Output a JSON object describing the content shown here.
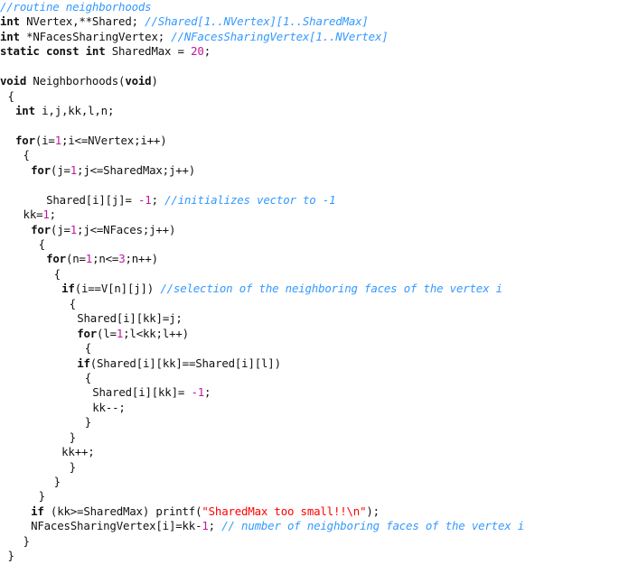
{
  "document": {
    "kind": "source-code-listing",
    "language": "C",
    "routine_name": "Neighborhoods"
  },
  "colors": {
    "text": "#111111",
    "keyword": "#111111",
    "number": "#C0179E",
    "comment": "#3399FF",
    "string": "#FF0000",
    "background": "#FFFFFF"
  },
  "code": {
    "lines": [
      {
        "indent": 0,
        "tokens": [
          {
            "t": "comment",
            "v": "//routine neighborhoods"
          }
        ]
      },
      {
        "indent": 0,
        "tokens": [
          {
            "t": "kw",
            "v": "int"
          },
          {
            "t": "plain",
            "v": " NVertex,**Shared; "
          },
          {
            "t": "comment",
            "v": "//Shared[1..NVertex][1..SharedMax]"
          }
        ]
      },
      {
        "indent": 0,
        "tokens": [
          {
            "t": "kw",
            "v": "int"
          },
          {
            "t": "plain",
            "v": " *NFacesSharingVertex; "
          },
          {
            "t": "comment",
            "v": "//NFacesSharingVertex[1..NVertex]"
          }
        ]
      },
      {
        "indent": 0,
        "tokens": [
          {
            "t": "kw",
            "v": "static const int"
          },
          {
            "t": "plain",
            "v": " SharedMax = "
          },
          {
            "t": "num",
            "v": "20"
          },
          {
            "t": "plain",
            "v": ";"
          }
        ]
      },
      {
        "indent": 0,
        "tokens": []
      },
      {
        "indent": 0,
        "tokens": [
          {
            "t": "kw",
            "v": "void"
          },
          {
            "t": "plain",
            "v": " Neighborhoods("
          },
          {
            "t": "kw",
            "v": "void"
          },
          {
            "t": "plain",
            "v": ")"
          }
        ]
      },
      {
        "indent": 1,
        "tokens": [
          {
            "t": "brace",
            "v": "{"
          }
        ]
      },
      {
        "indent": 2,
        "tokens": [
          {
            "t": "kw",
            "v": "int"
          },
          {
            "t": "plain",
            "v": " i,j,kk,l,n;"
          }
        ]
      },
      {
        "indent": 0,
        "tokens": []
      },
      {
        "indent": 2,
        "tokens": [
          {
            "t": "kw",
            "v": "for"
          },
          {
            "t": "plain",
            "v": "(i="
          },
          {
            "t": "num",
            "v": "1"
          },
          {
            "t": "plain",
            "v": ";i<=NVertex;i++)"
          }
        ]
      },
      {
        "indent": 3,
        "tokens": [
          {
            "t": "brace",
            "v": "{"
          }
        ]
      },
      {
        "indent": 4,
        "tokens": [
          {
            "t": "kw",
            "v": "for"
          },
          {
            "t": "plain",
            "v": "(j="
          },
          {
            "t": "num",
            "v": "1"
          },
          {
            "t": "plain",
            "v": ";j<=SharedMax;j++)"
          }
        ]
      },
      {
        "indent": 0,
        "tokens": []
      },
      {
        "indent": 6,
        "tokens": [
          {
            "t": "plain",
            "v": "Shared[i][j]= "
          },
          {
            "t": "num",
            "v": "-1"
          },
          {
            "t": "plain",
            "v": "; "
          },
          {
            "t": "comment",
            "v": "//initializes vector to -1"
          }
        ]
      },
      {
        "indent": 3,
        "tokens": [
          {
            "t": "plain",
            "v": "kk="
          },
          {
            "t": "num",
            "v": "1"
          },
          {
            "t": "plain",
            "v": ";"
          }
        ]
      },
      {
        "indent": 4,
        "tokens": [
          {
            "t": "kw",
            "v": "for"
          },
          {
            "t": "plain",
            "v": "(j="
          },
          {
            "t": "num",
            "v": "1"
          },
          {
            "t": "plain",
            "v": ";j<=NFaces;j++)"
          }
        ]
      },
      {
        "indent": 5,
        "tokens": [
          {
            "t": "brace",
            "v": "{"
          }
        ]
      },
      {
        "indent": 6,
        "tokens": [
          {
            "t": "kw",
            "v": "for"
          },
          {
            "t": "plain",
            "v": "(n="
          },
          {
            "t": "num",
            "v": "1"
          },
          {
            "t": "plain",
            "v": ";n<="
          },
          {
            "t": "num",
            "v": "3"
          },
          {
            "t": "plain",
            "v": ";n++)"
          }
        ]
      },
      {
        "indent": 7,
        "tokens": [
          {
            "t": "brace",
            "v": "{"
          }
        ]
      },
      {
        "indent": 8,
        "tokens": [
          {
            "t": "kw",
            "v": "if"
          },
          {
            "t": "plain",
            "v": "(i==V[n][j]) "
          },
          {
            "t": "comment",
            "v": "//selection of the neighboring faces of the vertex i"
          }
        ]
      },
      {
        "indent": 9,
        "tokens": [
          {
            "t": "brace",
            "v": "{"
          }
        ]
      },
      {
        "indent": 10,
        "tokens": [
          {
            "t": "plain",
            "v": "Shared[i][kk]=j;"
          }
        ]
      },
      {
        "indent": 10,
        "tokens": [
          {
            "t": "kw",
            "v": "for"
          },
          {
            "t": "plain",
            "v": "(l="
          },
          {
            "t": "num",
            "v": "1"
          },
          {
            "t": "plain",
            "v": ";l<kk;l++)"
          }
        ]
      },
      {
        "indent": 11,
        "tokens": [
          {
            "t": "brace",
            "v": "{"
          }
        ]
      },
      {
        "indent": 10,
        "tokens": [
          {
            "t": "kw",
            "v": "if"
          },
          {
            "t": "plain",
            "v": "(Shared[i][kk]==Shared[i][l])"
          }
        ]
      },
      {
        "indent": 11,
        "tokens": [
          {
            "t": "brace",
            "v": "{"
          }
        ]
      },
      {
        "indent": 12,
        "tokens": [
          {
            "t": "plain",
            "v": "Shared[i][kk]= "
          },
          {
            "t": "num",
            "v": "-1"
          },
          {
            "t": "plain",
            "v": ";"
          }
        ]
      },
      {
        "indent": 12,
        "tokens": [
          {
            "t": "plain",
            "v": "kk--;"
          }
        ]
      },
      {
        "indent": 11,
        "tokens": [
          {
            "t": "brace",
            "v": "}"
          }
        ]
      },
      {
        "indent": 9,
        "tokens": [
          {
            "t": "brace",
            "v": "}"
          }
        ]
      },
      {
        "indent": 8,
        "tokens": [
          {
            "t": "plain",
            "v": "kk++;"
          }
        ]
      },
      {
        "indent": 9,
        "tokens": [
          {
            "t": "brace",
            "v": "}"
          }
        ]
      },
      {
        "indent": 7,
        "tokens": [
          {
            "t": "brace",
            "v": "}"
          }
        ]
      },
      {
        "indent": 5,
        "tokens": [
          {
            "t": "brace",
            "v": "}"
          }
        ]
      },
      {
        "indent": 4,
        "tokens": [
          {
            "t": "kw",
            "v": "if"
          },
          {
            "t": "plain",
            "v": " (kk>=SharedMax) printf("
          },
          {
            "t": "string",
            "v": "\"SharedMax too small!!\\n\""
          },
          {
            "t": "plain",
            "v": ");"
          }
        ]
      },
      {
        "indent": 4,
        "tokens": [
          {
            "t": "plain",
            "v": "NFacesSharingVertex[i]=kk-"
          },
          {
            "t": "num",
            "v": "1"
          },
          {
            "t": "plain",
            "v": "; "
          },
          {
            "t": "comment",
            "v": "// number of neighboring faces of the vertex i"
          }
        ]
      },
      {
        "indent": 3,
        "tokens": [
          {
            "t": "brace",
            "v": "}"
          }
        ]
      },
      {
        "indent": 1,
        "tokens": [
          {
            "t": "brace",
            "v": "}"
          }
        ]
      }
    ]
  }
}
